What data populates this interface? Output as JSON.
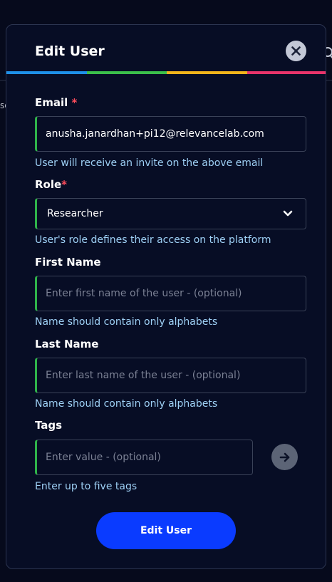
{
  "background": {
    "fragment_text": "se"
  },
  "modal": {
    "title": "Edit User",
    "rainbow_colors": [
      "#1e90e8",
      "#3bbf4a",
      "#f2b41b",
      "#e8336a"
    ]
  },
  "form": {
    "email": {
      "label": "Email",
      "required_mark": "*",
      "value": "anusha.janardhan+pi12@relevancelab.com",
      "hint": "User will receive an invite on the above email"
    },
    "role": {
      "label": "Role",
      "required_mark": "*",
      "value": "Researcher",
      "hint": "User's role defines their access on the platform"
    },
    "first_name": {
      "label": "First Name",
      "placeholder": "Enter first name of the user - (optional)",
      "hint": "Name should contain only alphabets"
    },
    "last_name": {
      "label": "Last Name",
      "placeholder": "Enter last name of the user - (optional)",
      "hint": "Name should contain only alphabets"
    },
    "tags": {
      "label": "Tags",
      "placeholder": "Enter value - (optional)",
      "hint": "Enter up to five tags"
    }
  },
  "submit_label": "Edit User"
}
